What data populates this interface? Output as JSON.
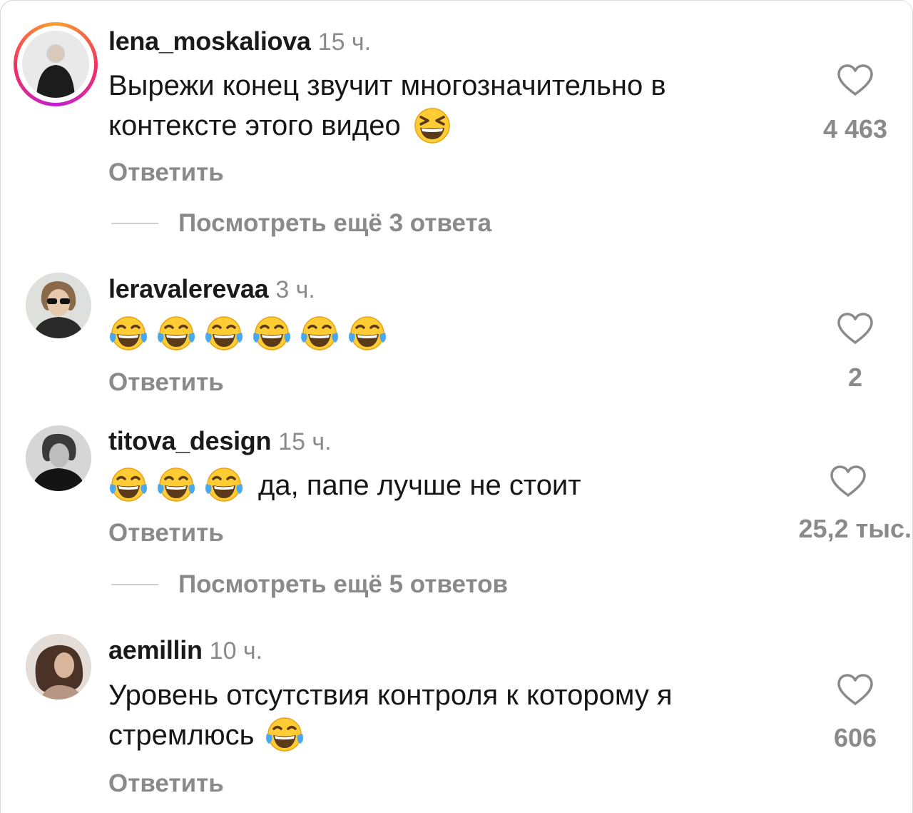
{
  "comments": [
    {
      "username": "lena_moskaliova",
      "time": "15 ч.",
      "lines": [
        "Вырежи конец звучит многозначительно в",
        "контексте этого видео"
      ],
      "emoji": [
        "grinning-squinting-face"
      ],
      "reply_label": "Ответить",
      "likes": "4 463",
      "has_story_ring": true,
      "more_replies": "Посмотреть ещё 3 ответа"
    },
    {
      "username": "leravalerevaa",
      "time": "3 ч.",
      "lines": [],
      "emoji": [
        "face-with-tears-of-joy",
        "face-with-tears-of-joy",
        "face-with-tears-of-joy",
        "face-with-tears-of-joy",
        "face-with-tears-of-joy",
        "face-with-tears-of-joy"
      ],
      "reply_label": "Ответить",
      "likes": "2"
    },
    {
      "username": "titova_design",
      "time": "15 ч.",
      "lines": [
        "да, папе лучше не стоит"
      ],
      "emoji": [
        "face-with-tears-of-joy",
        "face-with-tears-of-joy",
        "face-with-tears-of-joy"
      ],
      "reply_label": "Ответить",
      "likes": "25,2 тыс.",
      "more_replies": "Посмотреть ещё 5 ответов"
    },
    {
      "username": "aemillin",
      "time": "10 ч.",
      "lines": [
        "Уровень отсутствия контроля к которому я",
        "стремлюсь"
      ],
      "emoji": [
        "face-with-tears-of-joy"
      ],
      "reply_label": "Ответить",
      "likes": "606"
    }
  ],
  "colors": {
    "text": "#161616",
    "muted": "#8a8a8a",
    "story_ring": [
      "#f9a12e",
      "#f5335c",
      "#c41dd4"
    ]
  },
  "icons": [
    "heart-outline-icon",
    "grinning-squinting-face-emoji",
    "face-with-tears-of-joy-emoji"
  ]
}
